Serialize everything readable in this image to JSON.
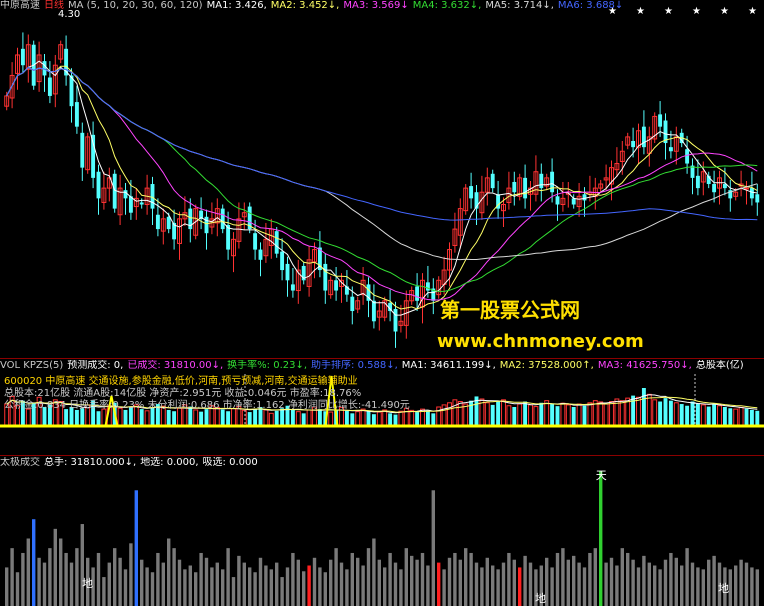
{
  "main_panel": {
    "header": [
      {
        "text": "中原高速",
        "color": "#c8c8c8"
      },
      {
        "text": "日线",
        "color": "#ff3030"
      },
      {
        "text": "MA (5, 10, 20, 30, 60, 120)",
        "color": "#c8c8c8"
      },
      {
        "text": "MA1: 3.426,",
        "color": "#ffffff"
      },
      {
        "text": "MA2: 3.452↓,",
        "color": "#ffff66"
      },
      {
        "text": "MA3: 3.569↓",
        "color": "#ff44ff"
      },
      {
        "text": "MA4: 3.632↓,",
        "color": "#33dd33"
      },
      {
        "text": "MA5: 3.714↓,",
        "color": "#d8d8d8"
      },
      {
        "text": "MA6: 3.688↓",
        "color": "#4466ff"
      }
    ],
    "high_label": "4.30",
    "star_marks": [
      "★",
      "★",
      "★",
      "★",
      "★",
      "★"
    ]
  },
  "volume_panel": {
    "header": [
      {
        "text": "VOL KPZS(5)",
        "color": "#c8c8c8"
      },
      {
        "text": "预测成交: 0,",
        "color": "#ffffff"
      },
      {
        "text": "已成交: 31810.00↓,",
        "color": "#ff44ff"
      },
      {
        "text": "换手率%: 0.23↓,",
        "color": "#33dd33"
      },
      {
        "text": "助手排序: 0.588↓,",
        "color": "#4466ff"
      },
      {
        "text": "MA1: 34611.199↓,",
        "color": "#ffffff"
      },
      {
        "text": "MA2: 37528.000↑,",
        "color": "#ffff66"
      },
      {
        "text": "MA3: 41625.750↓,",
        "color": "#ff44ff"
      },
      {
        "text": "总股本(亿)",
        "color": "#ffffff"
      }
    ],
    "info_lines": [
      "600020 中原高速 交通设施,参股金融,低价,河南,预亏预减,河南,交通运输辅助业",
      "总股本:21亿股  流通A股:14亿股  净资产:2.951元  收益:0.046元  市盈率:18.76%",
      "公积金:0.834  日换手率:0.23%  未分利润:0.686  市净率:1.162  净利润同比增长:-41.490元"
    ]
  },
  "lower_panel": {
    "header": [
      {
        "text": "太极成交",
        "color": "#c8c8c8"
      },
      {
        "text": "总手: 31810.000↓,",
        "color": "#ffffff"
      },
      {
        "text": "地选: 0.000,",
        "color": "#ffffff"
      },
      {
        "text": "吸选: 0.000",
        "color": "#ffffff"
      }
    ],
    "tian_label": "天",
    "di_labels": [
      "地",
      "地",
      "地"
    ]
  },
  "watermark": {
    "line1": "第一股票公式网",
    "line2": "www.chnmoney.com"
  },
  "chart_data": [
    {
      "type": "candlestick",
      "title": "中原高速 日线",
      "max_price_label": 4.3,
      "ylim": [
        2.7,
        4.35
      ],
      "up_color": "#ff3232",
      "down_color": "#54ffff",
      "ma_colors": {
        "MA5": "#ffffff",
        "MA10": "#ffff66",
        "MA20": "#ff44ff",
        "MA30": "#33dd33",
        "MA60": "#d8d8d8",
        "MA120": "#4466ff"
      },
      "ma_last": {
        "MA1": 3.426,
        "MA2": 3.452,
        "MA3": 3.569,
        "MA4": 3.632,
        "MA5": 3.714,
        "MA6": 3.688
      },
      "close": [
        3.95,
        4.05,
        4.15,
        4.1,
        4.2,
        4.0,
        4.15,
        4.05,
        3.95,
        4.1,
        4.2,
        4.05,
        3.9,
        3.8,
        3.6,
        3.75,
        3.55,
        3.45,
        3.5,
        3.55,
        3.4,
        3.5,
        3.45,
        3.38,
        3.45,
        3.42,
        3.5,
        3.4,
        3.3,
        3.35,
        3.3,
        3.25,
        3.35,
        3.38,
        3.3,
        3.4,
        3.35,
        3.28,
        3.35,
        3.4,
        3.3,
        3.2,
        3.25,
        3.35,
        3.38,
        3.3,
        3.2,
        3.15,
        3.25,
        3.3,
        3.18,
        3.1,
        3.05,
        3.0,
        3.1,
        3.05,
        3.15,
        3.2,
        3.1,
        3.0,
        3.05,
        3.0,
        3.05,
        2.98,
        2.9,
        2.95,
        3.05,
        2.95,
        2.85,
        2.9,
        2.95,
        2.9,
        2.8,
        2.85,
        2.95,
        3.0,
        2.95,
        3.05,
        3.0,
        2.95,
        3.05,
        3.1,
        3.2,
        3.3,
        3.4,
        3.5,
        3.45,
        3.4,
        3.48,
        3.55,
        3.5,
        3.4,
        3.42,
        3.5,
        3.48,
        3.55,
        3.45,
        3.5,
        3.58,
        3.5,
        3.55,
        3.48,
        3.42,
        3.45,
        3.48,
        3.42,
        3.46,
        3.44,
        3.48,
        3.5,
        3.52,
        3.55,
        3.6,
        3.62,
        3.68,
        3.75,
        3.7,
        3.78,
        3.7,
        3.75,
        3.85,
        3.8,
        3.72,
        3.68,
        3.75,
        3.72,
        3.62,
        3.55,
        3.5,
        3.58,
        3.52,
        3.48,
        3.55,
        3.5,
        3.45,
        3.48,
        3.52,
        3.5,
        3.45,
        3.43
      ]
    },
    {
      "type": "bar",
      "title": "VOL KPZS(5)",
      "series": [
        {
          "name": "已成交",
          "last": 31810.0
        },
        {
          "name": "MA1",
          "last": 34611.199
        },
        {
          "name": "MA2",
          "last": 37528.0
        },
        {
          "name": "MA3",
          "last": 41625.75
        }
      ],
      "values": [
        52,
        70,
        48,
        60,
        40,
        55,
        68,
        45,
        50,
        62,
        58,
        40,
        45,
        38,
        42,
        50,
        60,
        35,
        40,
        48,
        55,
        42,
        38,
        45,
        50,
        40,
        36,
        44,
        52,
        47,
        38,
        35,
        42,
        50,
        46,
        38,
        34,
        40,
        48,
        44,
        39,
        35,
        41,
        46,
        37,
        33,
        40,
        45,
        38,
        30,
        36,
        42,
        48,
        39,
        34,
        30,
        38,
        45,
        40,
        35,
        33,
        37,
        44,
        36,
        30,
        34,
        40,
        35,
        28,
        33,
        38,
        30,
        27,
        35,
        42,
        37,
        33,
        40,
        36,
        30,
        45,
        50,
        55,
        62,
        58,
        52,
        60,
        70,
        64,
        55,
        50,
        58,
        62,
        48,
        45,
        52,
        58,
        50,
        46,
        55,
        60,
        52,
        47,
        54,
        50,
        45,
        52,
        48,
        55,
        60,
        57,
        52,
        58,
        64,
        60,
        66,
        72,
        68,
        90,
        75,
        62,
        58,
        66,
        60,
        55,
        52,
        48,
        58,
        54,
        50,
        46,
        52,
        48,
        45,
        42,
        40,
        44,
        41,
        38,
        36
      ]
    },
    {
      "type": "bar",
      "title": "太极成交",
      "series": [
        {
          "name": "总手",
          "last": 31810.0
        },
        {
          "name": "地选",
          "last": 0.0
        },
        {
          "name": "吸选",
          "last": 0.0
        }
      ],
      "values": [
        40,
        60,
        35,
        55,
        70,
        90,
        50,
        45,
        60,
        80,
        70,
        55,
        45,
        60,
        85,
        50,
        40,
        55,
        30,
        45,
        60,
        50,
        38,
        65,
        120,
        48,
        40,
        35,
        55,
        45,
        70,
        60,
        48,
        38,
        42,
        35,
        55,
        50,
        40,
        45,
        38,
        60,
        30,
        52,
        45,
        40,
        35,
        50,
        42,
        38,
        45,
        30,
        40,
        55,
        48,
        36,
        42,
        50,
        40,
        35,
        48,
        60,
        45,
        38,
        55,
        50,
        42,
        60,
        70,
        48,
        40,
        55,
        45,
        38,
        60,
        52,
        48,
        55,
        42,
        120,
        45,
        38,
        50,
        55,
        48,
        60,
        55,
        45,
        40,
        50,
        42,
        38,
        45,
        55,
        48,
        40,
        52,
        45,
        38,
        42,
        50,
        40,
        55,
        60,
        48,
        52,
        45,
        40,
        55,
        60,
        140,
        45,
        50,
        42,
        60,
        55,
        48,
        40,
        52,
        45,
        42,
        38,
        48,
        55,
        50,
        42,
        60,
        45,
        40,
        38,
        48,
        52,
        45,
        40,
        38,
        42,
        48,
        45,
        40,
        38
      ],
      "highlights": {
        "80": "#ff2020",
        "110": "#30d030",
        "5": "#3070ff",
        "24": "#3070ff",
        "56": "#ff2020",
        "95": "#ff2020"
      }
    }
  ]
}
